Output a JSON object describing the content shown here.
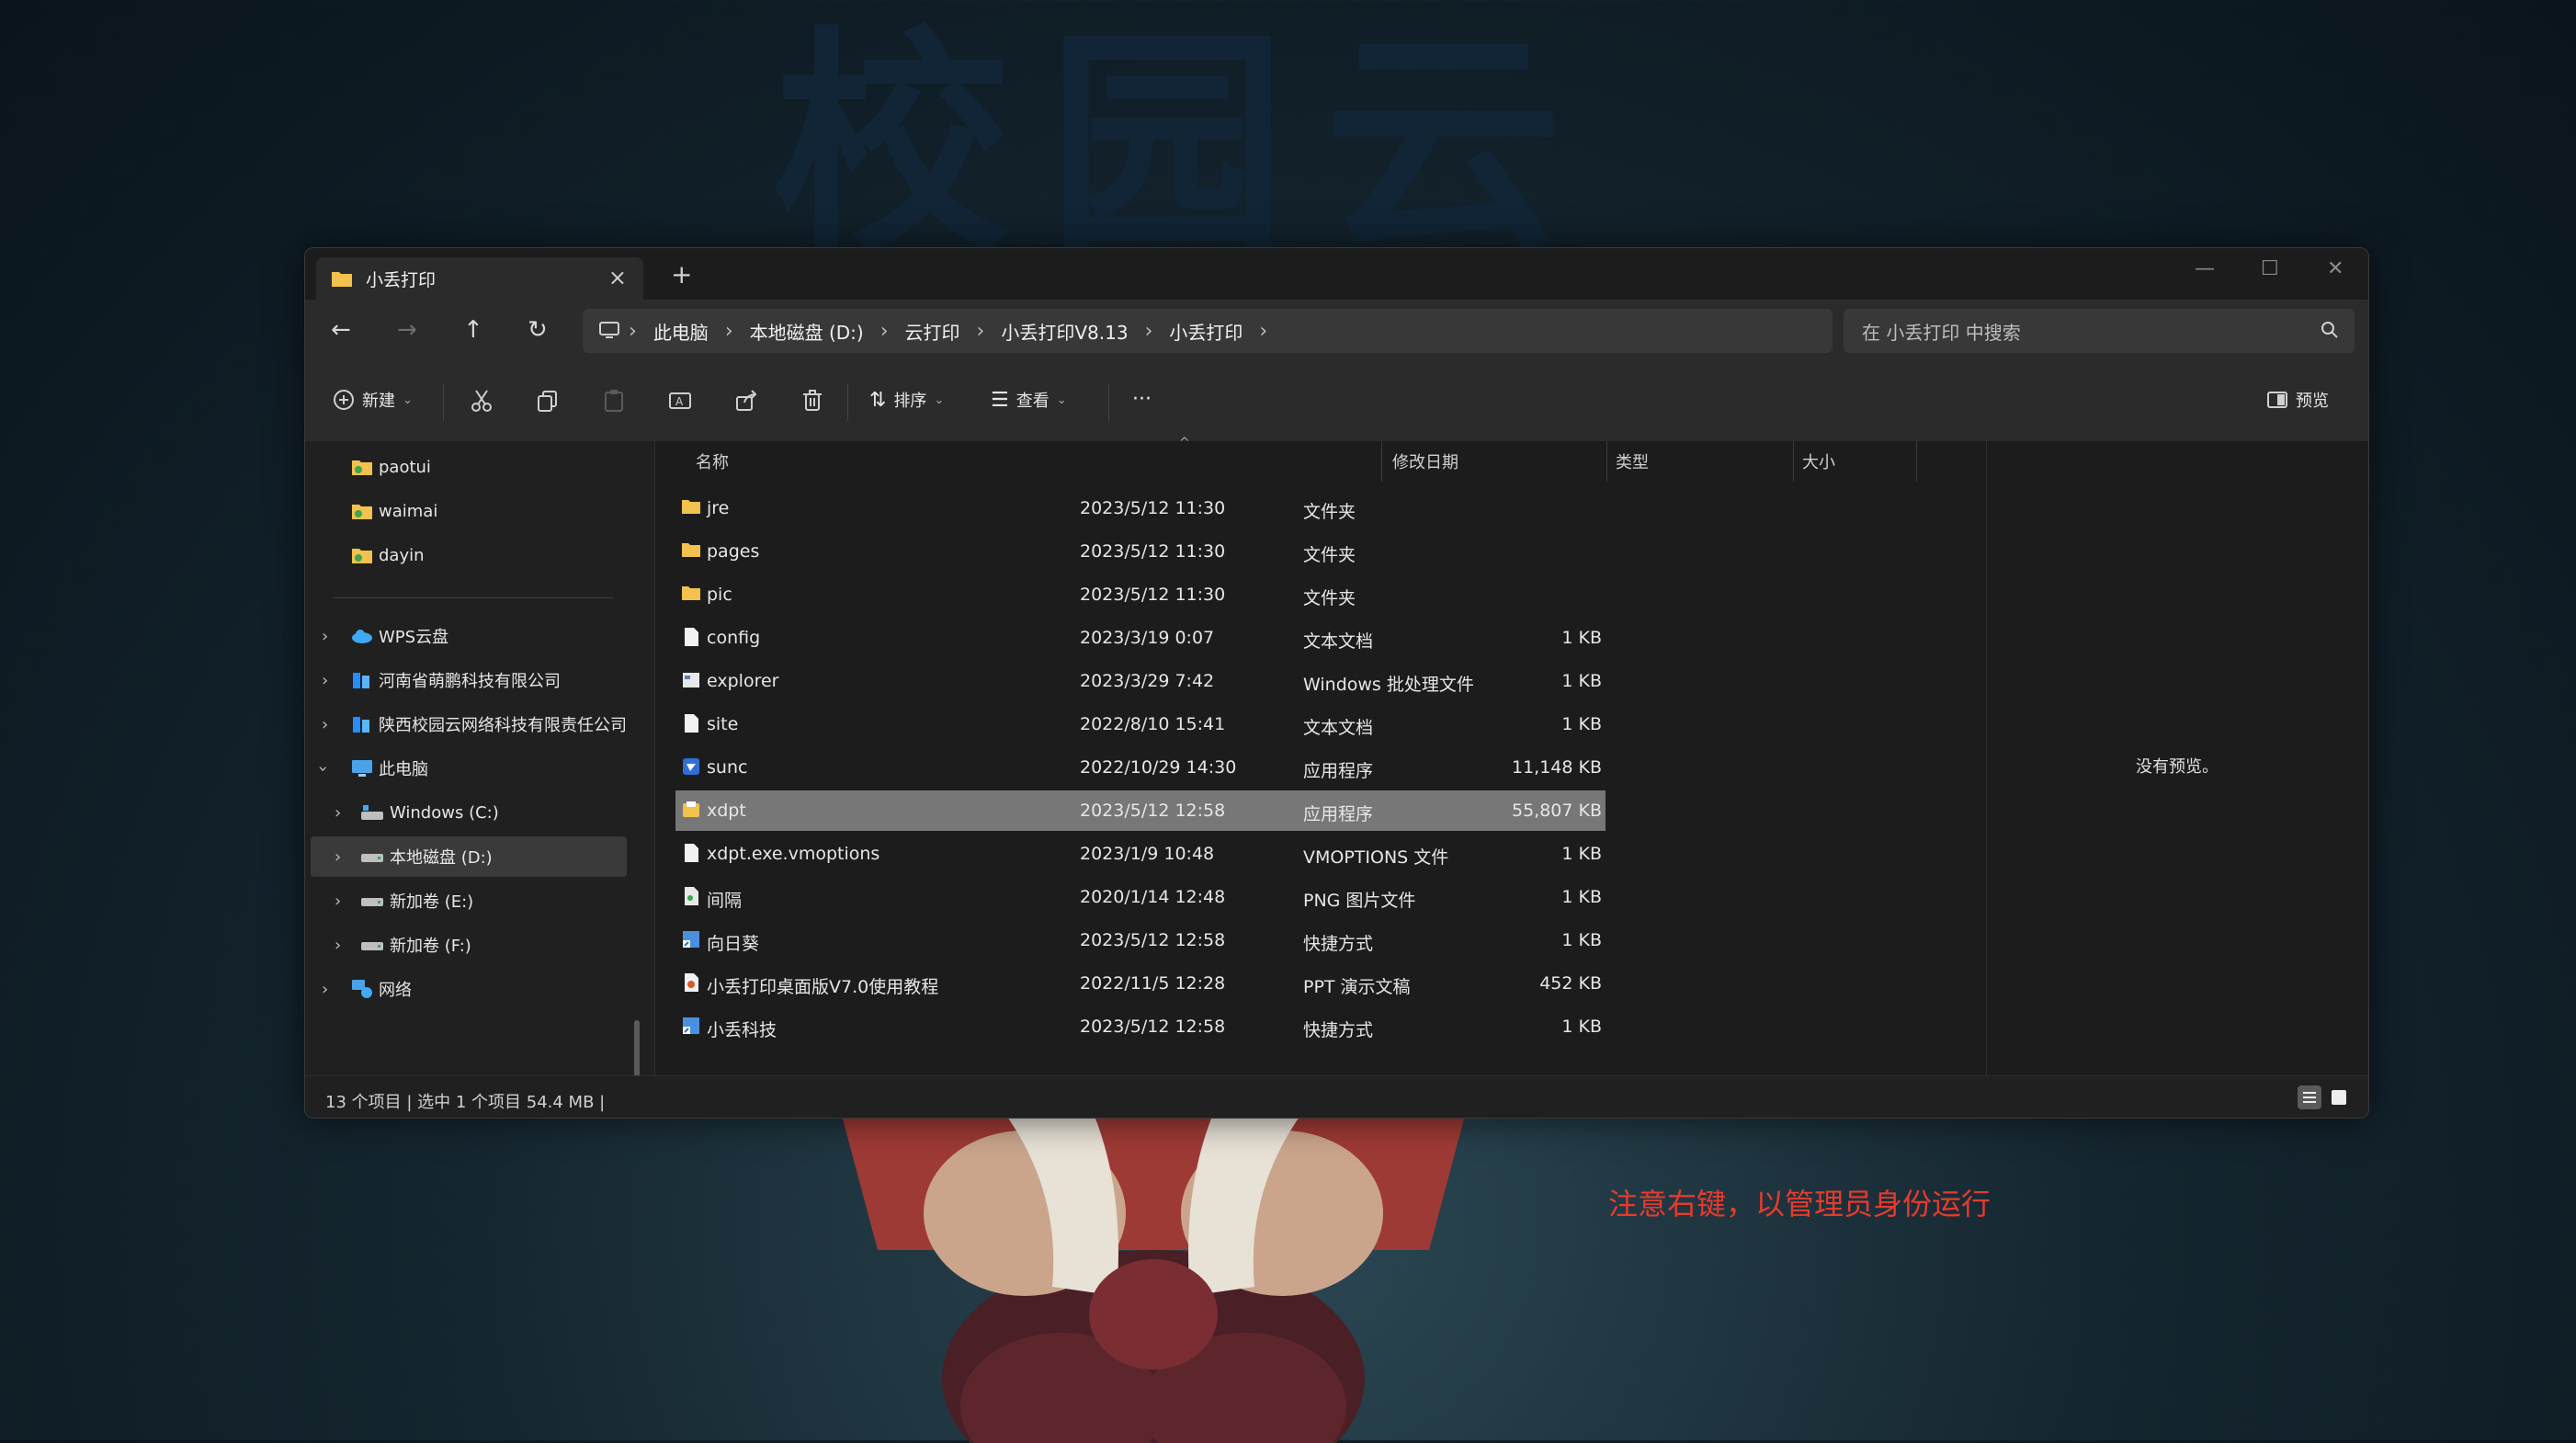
{
  "background": {
    "title": "校园云",
    "annotation": "注意右键，以管理员身份运行",
    "annotation_color": "#e53b2e"
  },
  "window": {
    "tab_title": "小丢打印",
    "tab_close": "×",
    "new_tab": "+",
    "controls": {
      "minimize": "—",
      "maximize": "☐",
      "close": "✕"
    }
  },
  "nav": {
    "back": "←",
    "forward": "→",
    "up": "↑",
    "refresh": "↻",
    "breadcrumb": [
      "此电脑",
      "本地磁盘 (D:)",
      "云打印",
      "小丢打印V8.13",
      "小丢打印"
    ],
    "breadcrumb_sep": "›",
    "search_placeholder": "在 小丢打印 中搜索"
  },
  "toolbar": {
    "new_label": "新建",
    "sort_label": "排序",
    "view_label": "查看",
    "more_label": "···",
    "preview_label": "预览"
  },
  "sidebar": {
    "pinned": [
      "paotui",
      "waimai",
      "dayin"
    ],
    "locations": [
      {
        "label": "WPS云盘",
        "icon": "cloud-icon",
        "expanded": false
      },
      {
        "label": "河南省萌鹏科技有限公司",
        "icon": "onedrive-icon",
        "expanded": false
      },
      {
        "label": "陕西校园云网络科技有限责任公司",
        "icon": "onedrive-icon",
        "expanded": false
      },
      {
        "label": "此电脑",
        "icon": "computer-icon",
        "expanded": true
      }
    ],
    "drives": [
      {
        "label": "Windows (C:)",
        "selected": false
      },
      {
        "label": "本地磁盘 (D:)",
        "selected": true
      },
      {
        "label": "新加卷 (E:)",
        "selected": false
      },
      {
        "label": "新加卷 (F:)",
        "selected": false
      }
    ],
    "network": "网络"
  },
  "columns": {
    "name": "名称",
    "date": "修改日期",
    "type": "类型",
    "size": "大小"
  },
  "files": [
    {
      "name": "jre",
      "date": "2023/5/12 11:30",
      "type": "文件夹",
      "size": "",
      "icon": "folder-icon"
    },
    {
      "name": "pages",
      "date": "2023/5/12 11:30",
      "type": "文件夹",
      "size": "",
      "icon": "folder-icon"
    },
    {
      "name": "pic",
      "date": "2023/5/12 11:30",
      "type": "文件夹",
      "size": "",
      "icon": "folder-icon"
    },
    {
      "name": "config",
      "date": "2023/3/19 0:07",
      "type": "文本文档",
      "size": "1 KB",
      "icon": "text-file-icon"
    },
    {
      "name": "explorer",
      "date": "2023/3/29 7:42",
      "type": "Windows 批处理文件",
      "size": "1 KB",
      "icon": "batch-file-icon"
    },
    {
      "name": "site",
      "date": "2022/8/10 15:41",
      "type": "文本文档",
      "size": "1 KB",
      "icon": "text-file-icon"
    },
    {
      "name": "sunc",
      "date": "2022/10/29 14:30",
      "type": "应用程序",
      "size": "11,148 KB",
      "icon": "app-icon"
    },
    {
      "name": "xdpt",
      "date": "2023/5/12 12:58",
      "type": "应用程序",
      "size": "55,807 KB",
      "icon": "app-icon",
      "selected": true
    },
    {
      "name": "xdpt.exe.vmoptions",
      "date": "2023/1/9 10:48",
      "type": "VMOPTIONS 文件",
      "size": "1 KB",
      "icon": "text-file-icon"
    },
    {
      "name": "间隔",
      "date": "2020/1/14 12:48",
      "type": "PNG 图片文件",
      "size": "1 KB",
      "icon": "image-file-icon"
    },
    {
      "name": "向日葵",
      "date": "2023/5/12 12:58",
      "type": "快捷方式",
      "size": "1 KB",
      "icon": "shortcut-icon"
    },
    {
      "name": "小丢打印桌面版V7.0使用教程",
      "date": "2022/11/5 12:28",
      "type": "PPT 演示文稿",
      "size": "452 KB",
      "icon": "ppt-file-icon"
    },
    {
      "name": "小丢科技",
      "date": "2023/5/12 12:58",
      "type": "快捷方式",
      "size": "1 KB",
      "icon": "shortcut-icon"
    }
  ],
  "preview": {
    "message": "没有预览。"
  },
  "status": {
    "text": "13 个项目  |  选中 1 个项目  54.4 MB  |"
  }
}
